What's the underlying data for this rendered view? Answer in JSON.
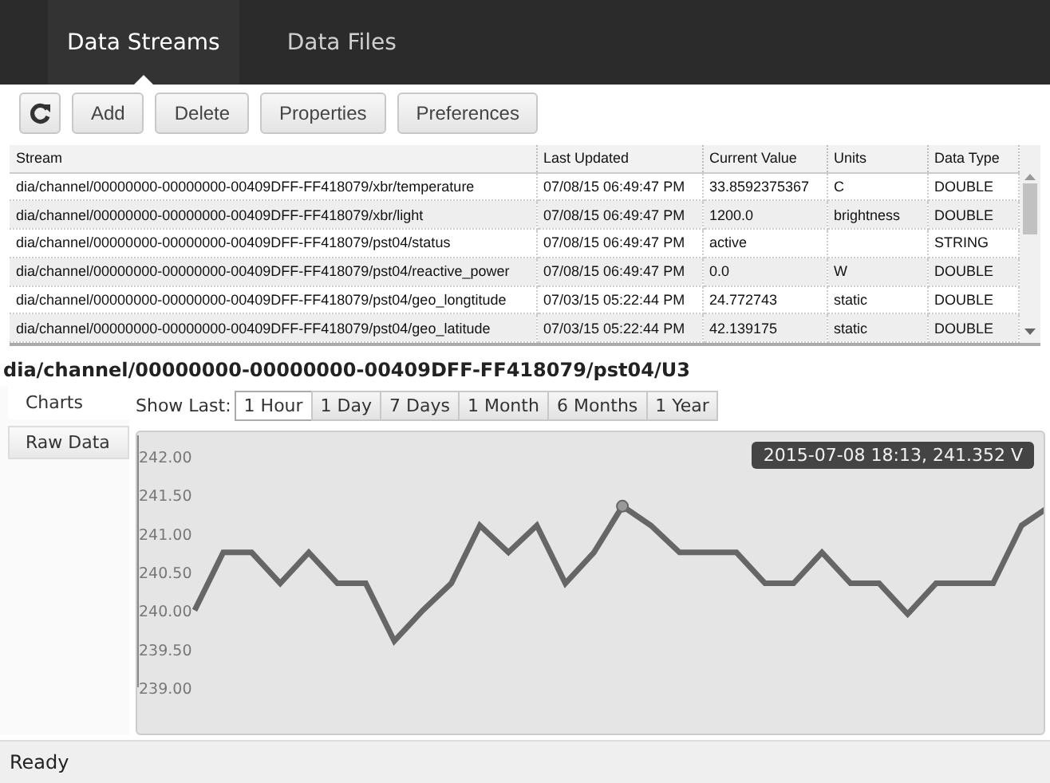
{
  "nav_tabs": [
    {
      "label": "Data Streams",
      "selected": true
    },
    {
      "label": "Data Files",
      "selected": false
    }
  ],
  "toolbar": {
    "buttons": [
      {
        "kind": "refresh"
      },
      {
        "kind": "text",
        "label": "Add"
      },
      {
        "kind": "text",
        "label": "Delete"
      },
      {
        "kind": "text",
        "label": "Properties"
      },
      {
        "kind": "text",
        "label": "Preferences"
      }
    ]
  },
  "table": {
    "columns": [
      "Stream",
      "Last Updated",
      "Current Value",
      "Units",
      "Data Type"
    ],
    "rows": [
      [
        "dia/channel/00000000-00000000-00409DFF-FF418079/xbr/temperature",
        "07/08/15 06:49:47 PM",
        "33.8592375367",
        "C",
        "DOUBLE"
      ],
      [
        "dia/channel/00000000-00000000-00409DFF-FF418079/xbr/light",
        "07/08/15 06:49:47 PM",
        "1200.0",
        "brightness",
        "DOUBLE"
      ],
      [
        "dia/channel/00000000-00000000-00409DFF-FF418079/pst04/status",
        "07/08/15 06:49:47 PM",
        "active",
        "",
        "STRING"
      ],
      [
        "dia/channel/00000000-00000000-00409DFF-FF418079/pst04/reactive_power",
        "07/08/15 06:49:47 PM",
        "0.0",
        "W",
        "DOUBLE"
      ],
      [
        "dia/channel/00000000-00000000-00409DFF-FF418079/pst04/geo_longtitude",
        "07/03/15 05:22:44 PM",
        "24.772743",
        "static",
        "DOUBLE"
      ],
      [
        "dia/channel/00000000-00000000-00409DFF-FF418079/pst04/geo_latitude",
        "07/03/15 05:22:44 PM",
        "42.139175",
        "static",
        "DOUBLE"
      ]
    ]
  },
  "detail": {
    "title": "dia/channel/00000000-00000000-00409DFF-FF418079/pst04/U3",
    "side_tabs": [
      {
        "label": "Charts",
        "selected": true
      },
      {
        "label": "Raw Data",
        "selected": false
      }
    ],
    "show_last_label": "Show Last:",
    "ranges": [
      {
        "label": "1 Hour",
        "selected": true
      },
      {
        "label": "1 Day",
        "selected": false
      },
      {
        "label": "7 Days",
        "selected": false
      },
      {
        "label": "1 Month",
        "selected": false
      },
      {
        "label": "6 Months",
        "selected": false
      },
      {
        "label": "1 Year",
        "selected": false
      }
    ],
    "chart_data": {
      "type": "line",
      "ylim": [
        239,
        242
      ],
      "yticks": [
        {
          "value": 242,
          "label": "242.00"
        },
        {
          "value": 241.5,
          "label": "241.50"
        },
        {
          "value": 241,
          "label": "241.00"
        },
        {
          "value": 240.5,
          "label": "240.50"
        },
        {
          "value": 240,
          "label": "240.00"
        },
        {
          "value": 239.5,
          "label": "239.50"
        },
        {
          "value": 239,
          "label": "239.00"
        }
      ],
      "series": [
        {
          "color": "#666666",
          "values": [
            240.0,
            240.75,
            240.75,
            240.35,
            240.75,
            240.35,
            240.35,
            239.6,
            240.0,
            240.35,
            241.1,
            240.75,
            241.1,
            240.35,
            240.75,
            241.35,
            241.1,
            240.75,
            240.75,
            240.75,
            240.35,
            240.35,
            240.75,
            240.35,
            240.35,
            239.95,
            240.35,
            240.35,
            240.35,
            241.1,
            241.35
          ]
        }
      ],
      "annotations": [
        "2015-07-08 18:13, 241.352 V"
      ]
    }
  },
  "status_bar": "Ready"
}
